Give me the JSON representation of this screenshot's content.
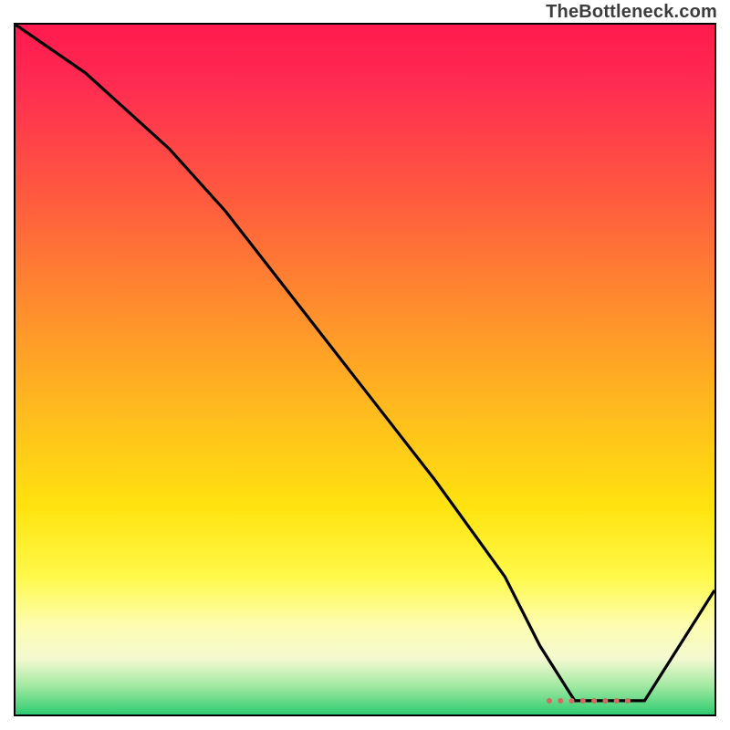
{
  "watermark": "TheBottleneck.com",
  "chart_data": {
    "type": "line",
    "title": "",
    "xlabel": "",
    "ylabel": "",
    "xlim": [
      0,
      100
    ],
    "ylim": [
      0,
      100
    ],
    "grid": false,
    "background": "gradient red→yellow→green (vertical)",
    "series": [
      {
        "name": "black-curve",
        "color": "#000000",
        "x": [
          0,
          10,
          22,
          30,
          40,
          50,
          60,
          70,
          75,
          80,
          85,
          90,
          100
        ],
        "y": [
          100,
          93,
          82,
          73,
          60,
          47,
          34,
          20,
          10,
          2,
          2,
          2,
          18
        ]
      }
    ],
    "annotations": [
      {
        "name": "highlight-segment",
        "style": "red-dotted",
        "y": 2,
        "x_start": 76,
        "x_end": 88
      }
    ]
  }
}
